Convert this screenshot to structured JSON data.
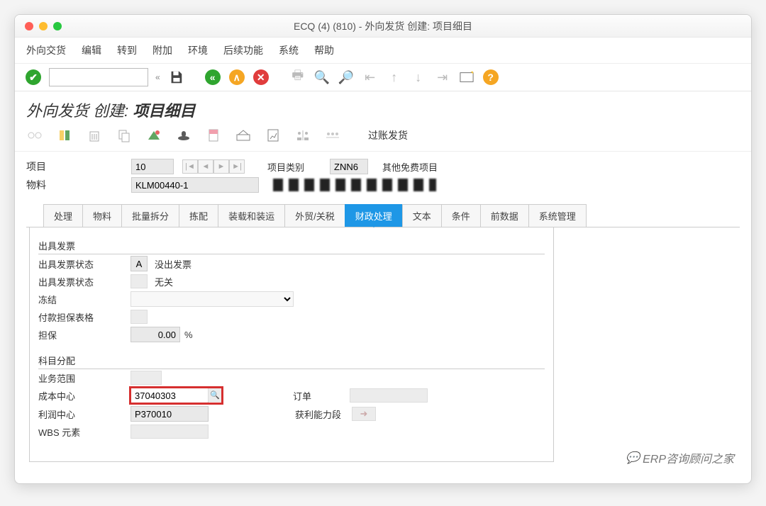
{
  "window": {
    "title": "ECQ (4) (810) - 外向发货  创建: 项目细目"
  },
  "menubar": [
    "外向交货",
    "编辑",
    "转到",
    "附加",
    "环境",
    "后续功能",
    "系统",
    "帮助"
  ],
  "toolbar2": {
    "post_goods": "过账发货"
  },
  "page_title": {
    "prefix": "外向发货  创建: ",
    "bold": "项目细目"
  },
  "header": {
    "item_label": "项目",
    "item_value": "10",
    "item_cat_label": "项目类别",
    "item_cat_value": "ZNN6",
    "item_cat_text": "其他免费项目",
    "material_label": "物料",
    "material_value": "KLM00440-1"
  },
  "tabs": [
    "处理",
    "物料",
    "批量拆分",
    "拣配",
    "装载和装运",
    "外贸/关税",
    "财政处理",
    "文本",
    "条件",
    "前数据",
    "系统管理"
  ],
  "active_tab_index": 6,
  "billing": {
    "section": "出具发票",
    "status1_label": "出具发票状态",
    "status1_code": "A",
    "status1_text": "没出发票",
    "status2_label": "出具发票状态",
    "status2_text": "无关",
    "freeze_label": "冻结",
    "payment_label": "付款担保表格",
    "guarantee_label": "担保",
    "guarantee_value": "0.00",
    "guarantee_unit": "%"
  },
  "assign": {
    "section": "科目分配",
    "biz_label": "业务范围",
    "cost_label": "成本中心",
    "cost_value": "37040303",
    "order_label": "订单",
    "profit_label": "利润中心",
    "profit_value": "P370010",
    "profseg_label": "获利能力段",
    "wbs_label": "WBS 元素"
  },
  "watermark": "ERP咨询顾问之家"
}
